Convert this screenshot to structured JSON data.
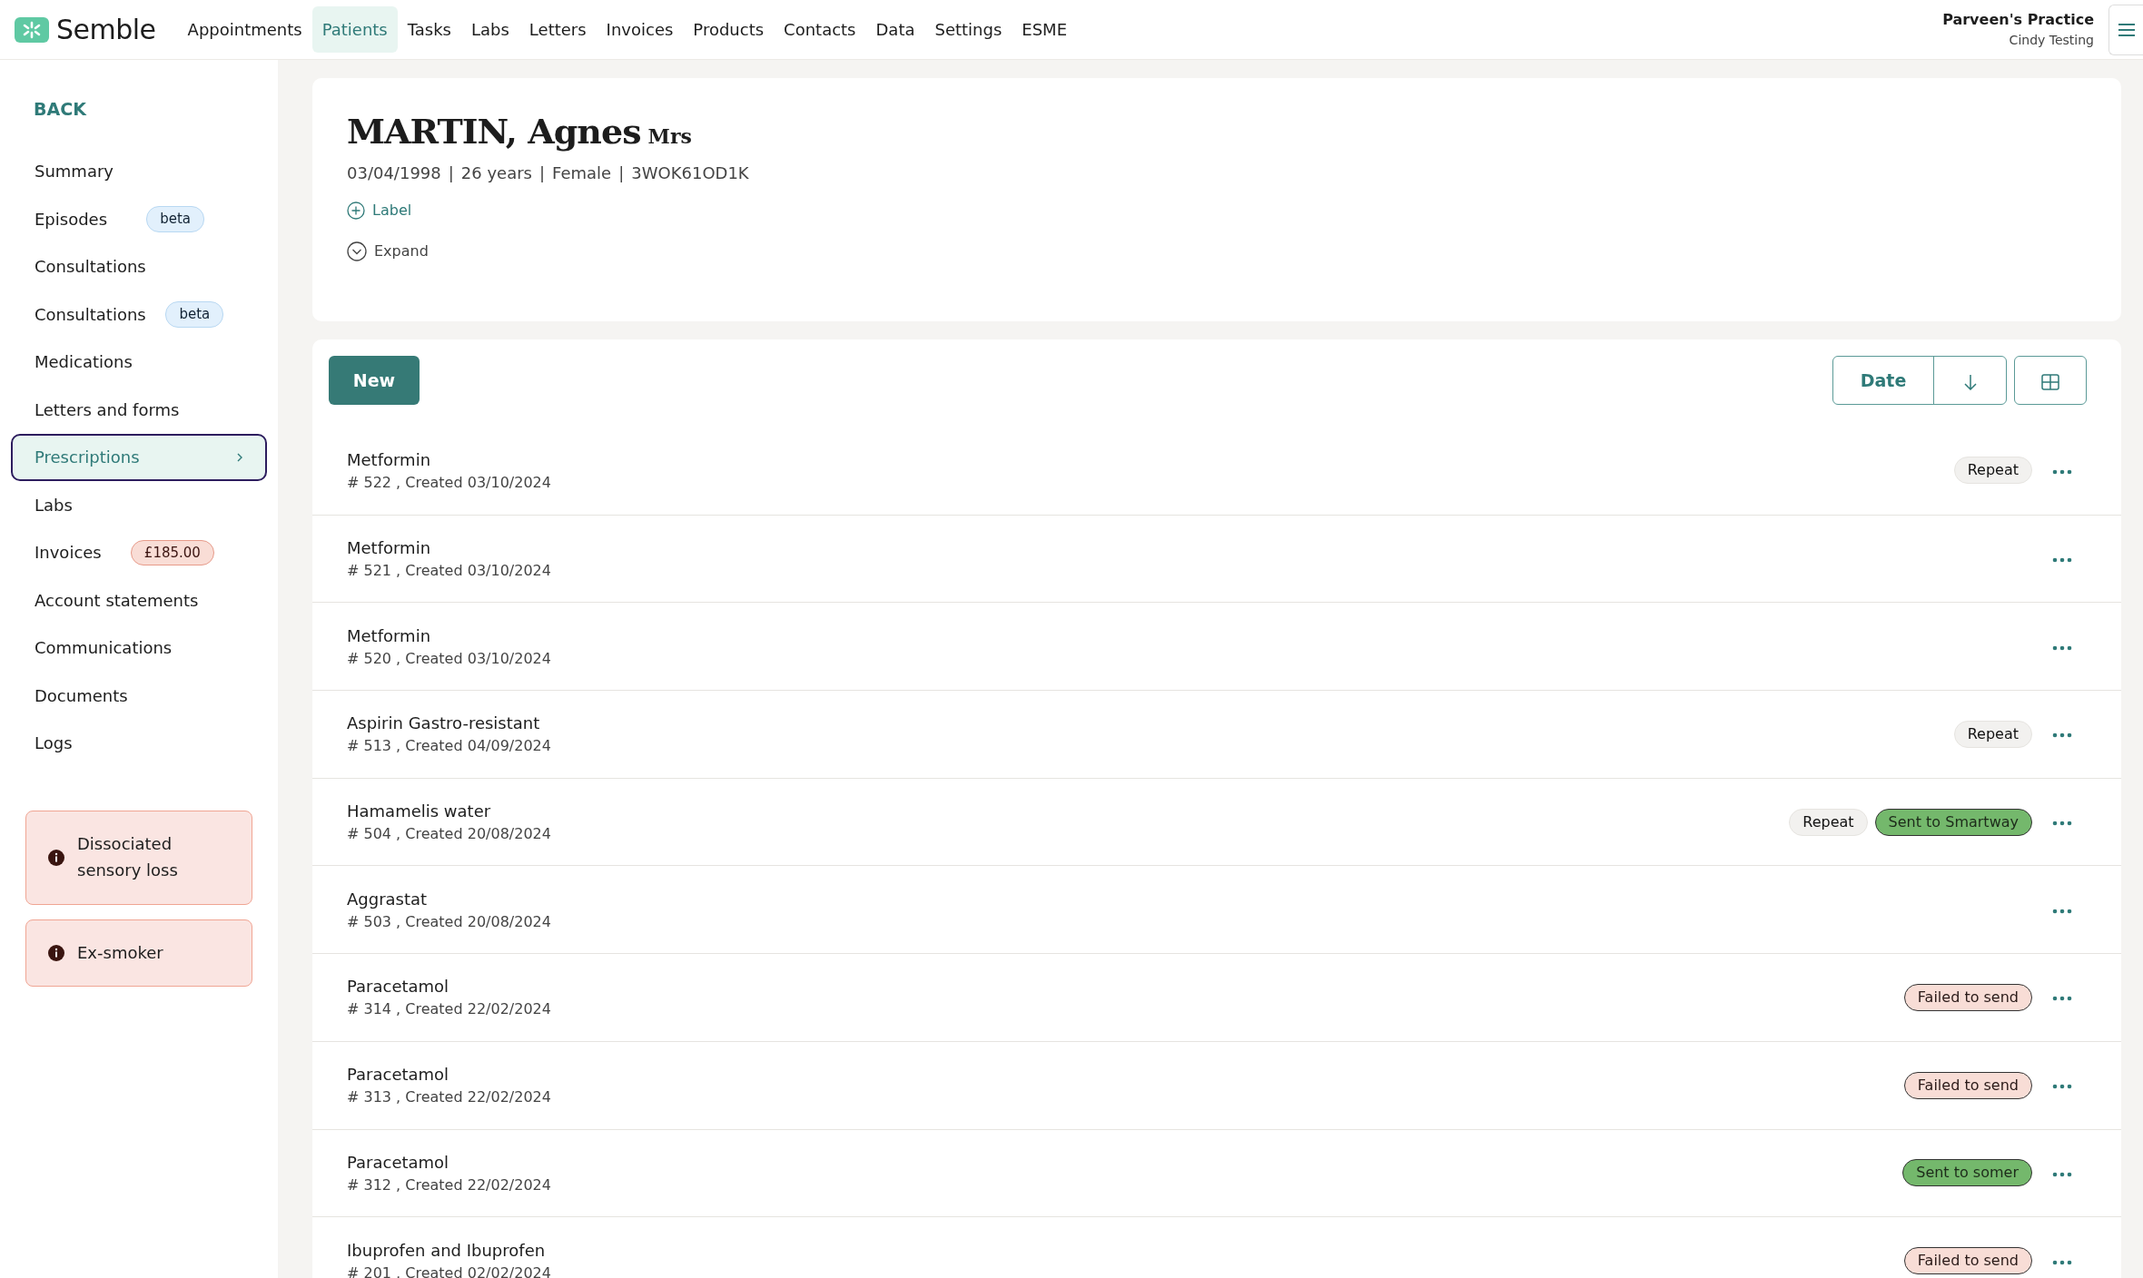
{
  "brand": {
    "name": "Semble"
  },
  "nav": [
    {
      "label": "Appointments",
      "selected": false
    },
    {
      "label": "Patients",
      "selected": true
    },
    {
      "label": "Tasks",
      "selected": false
    },
    {
      "label": "Labs",
      "selected": false
    },
    {
      "label": "Letters",
      "selected": false
    },
    {
      "label": "Invoices",
      "selected": false
    },
    {
      "label": "Products",
      "selected": false
    },
    {
      "label": "Contacts",
      "selected": false
    },
    {
      "label": "Data",
      "selected": false
    },
    {
      "label": "Settings",
      "selected": false
    },
    {
      "label": "ESME",
      "selected": false
    }
  ],
  "account": {
    "practice": "Parveen's Practice",
    "user": "Cindy Testing"
  },
  "sidebar": {
    "back": "BACK",
    "items": [
      {
        "label": "Summary",
        "selected": false
      },
      {
        "label": "Episodes",
        "selected": false,
        "badge": {
          "text": "beta",
          "kind": "info"
        }
      },
      {
        "label": "Consultations",
        "selected": false
      },
      {
        "label": "Consultations",
        "selected": false,
        "badge": {
          "text": "beta",
          "kind": "info"
        }
      },
      {
        "label": "Medications",
        "selected": false
      },
      {
        "label": "Letters and forms",
        "selected": false
      },
      {
        "label": "Prescriptions",
        "selected": true
      },
      {
        "label": "Labs",
        "selected": false
      },
      {
        "label": "Invoices",
        "selected": false,
        "badge": {
          "text": "£185.00",
          "kind": "danger"
        }
      },
      {
        "label": "Account statements",
        "selected": false
      },
      {
        "label": "Communications",
        "selected": false
      },
      {
        "label": "Documents",
        "selected": false
      },
      {
        "label": "Logs",
        "selected": false
      }
    ],
    "alerts": [
      {
        "text": "Dissociated sensory loss"
      },
      {
        "text": "Ex-smoker"
      }
    ]
  },
  "patient": {
    "name": "MARTIN, Agnes",
    "title": "Mrs",
    "details": [
      "03/04/1998",
      "26 years",
      "Female",
      "3WOK61OD1K"
    ],
    "detail_separator": "|",
    "label_action": "Label",
    "expand_action": "Expand"
  },
  "toolbar": {
    "new": "New",
    "sort": "Date"
  },
  "prescriptions": [
    {
      "name": "Metformin",
      "meta": "# 522 , Created 03/10/2024",
      "tags": [
        {
          "label": "Repeat",
          "kind": "repeat"
        }
      ]
    },
    {
      "name": "Metformin",
      "meta": "# 521 , Created 03/10/2024"
    },
    {
      "name": "Metformin",
      "meta": "# 520 , Created 03/10/2024"
    },
    {
      "name": "Aspirin Gastro-resistant",
      "meta": "# 513 , Created 04/09/2024",
      "tags": [
        {
          "label": "Repeat",
          "kind": "repeat"
        }
      ]
    },
    {
      "name": "Hamamelis water",
      "meta": "# 504 , Created 20/08/2024",
      "tags": [
        {
          "label": "Repeat",
          "kind": "repeat"
        },
        {
          "label": "Sent to Smartway",
          "kind": "sent"
        }
      ]
    },
    {
      "name": "Aggrastat",
      "meta": "# 503 , Created 20/08/2024"
    },
    {
      "name": "Paracetamol",
      "meta": "# 314 , Created 22/02/2024",
      "tags": [
        {
          "label": "Failed to send",
          "kind": "failed"
        }
      ]
    },
    {
      "name": "Paracetamol",
      "meta": "# 313 , Created 22/02/2024",
      "tags": [
        {
          "label": "Failed to send",
          "kind": "failed"
        }
      ]
    },
    {
      "name": "Paracetamol",
      "meta": "# 312 , Created 22/02/2024",
      "tags": [
        {
          "label": "Sent to somer",
          "kind": "sent"
        }
      ]
    },
    {
      "name": "Ibuprofen and Ibuprofen",
      "meta": "# 201 , Created 02/02/2024",
      "tags": [
        {
          "label": "Failed to send",
          "kind": "failed"
        }
      ]
    }
  ]
}
